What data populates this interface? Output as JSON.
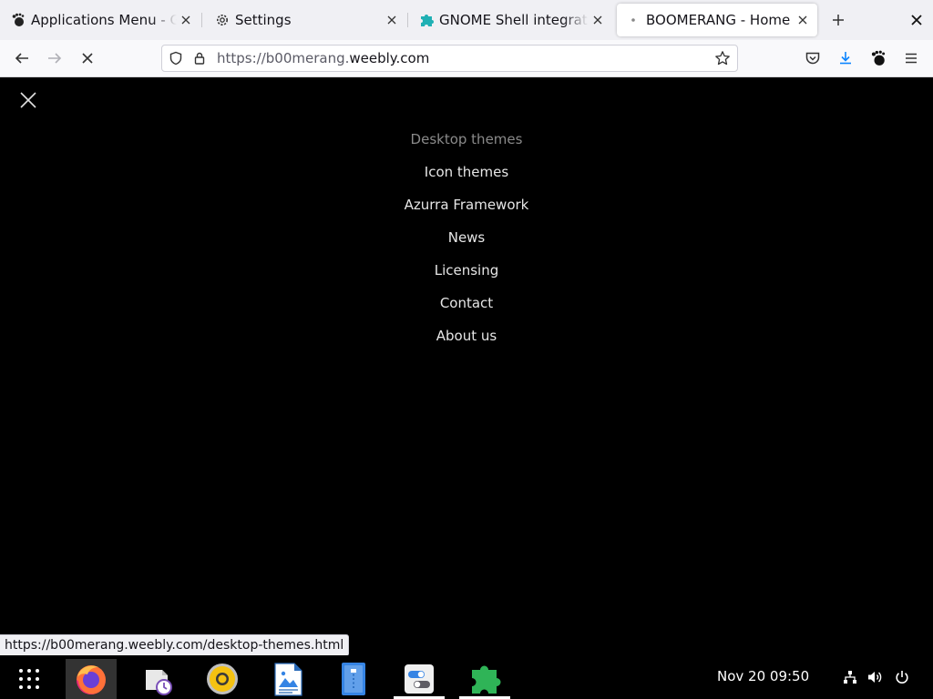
{
  "browser": {
    "tabs": [
      {
        "title": "Applications Menu - GNO",
        "icon": "gnome-foot-icon",
        "active": false
      },
      {
        "title": "Settings",
        "icon": "gear-icon",
        "active": false
      },
      {
        "title": "GNOME Shell integration",
        "icon": "puzzle-icon",
        "active": false
      },
      {
        "title": "BOOMERANG - Home",
        "icon": "loading-dot-icon",
        "active": true
      }
    ],
    "url": {
      "prefix": "https://b00merang.",
      "domain": "weebly.com"
    }
  },
  "page": {
    "menu_items": [
      {
        "label": "Desktop themes"
      },
      {
        "label": "Icon themes"
      },
      {
        "label": "Azurra Framework"
      },
      {
        "label": "News"
      },
      {
        "label": "Licensing"
      },
      {
        "label": "Contact"
      },
      {
        "label": "About us"
      }
    ],
    "status_url": "https://b00merang.weebly.com/desktop-themes.html"
  },
  "taskbar": {
    "apps": [
      {
        "name": "app-grid-icon"
      },
      {
        "name": "firefox-icon"
      },
      {
        "name": "mail-scheduler-icon"
      },
      {
        "name": "music-player-icon"
      },
      {
        "name": "image-viewer-icon"
      },
      {
        "name": "file-manager-icon"
      },
      {
        "name": "tweaks-icon"
      },
      {
        "name": "extensions-icon"
      }
    ],
    "clock": "Nov 20  09:50"
  },
  "colors": {
    "accent_blue": "#0a84ff",
    "extension_green": "#2fb457"
  }
}
